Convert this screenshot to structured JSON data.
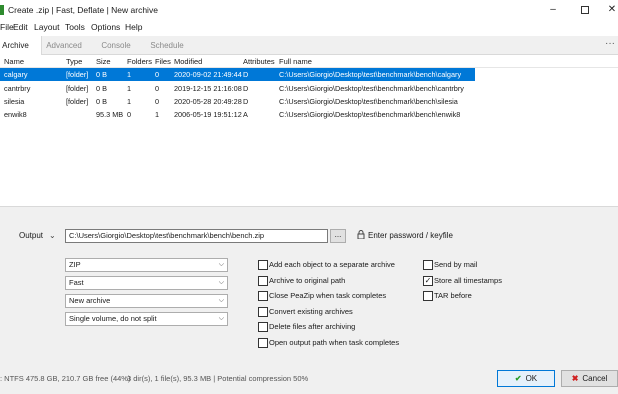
{
  "window": {
    "title": "Create .zip | Fast, Deflate | New archive",
    "minimize": "–",
    "close": "✕"
  },
  "menu": [
    "File",
    "Edit",
    "Layout",
    "Tools",
    "Options",
    "Help"
  ],
  "tabs": [
    "Archive",
    "Advanced",
    "Console",
    "Schedule"
  ],
  "tab_more": "···",
  "columns": [
    "Name",
    "Type",
    "Size",
    "Folders",
    "Files",
    "Modified",
    "Attributes",
    "Full name"
  ],
  "rows": [
    [
      "calgary",
      "[folder]",
      "0 B",
      "1",
      "0",
      "2020-09-02 21:49:44",
      "D",
      "C:\\Users\\Giorgio\\Desktop\\test\\benchmark\\bench\\calgary"
    ],
    [
      "cantrbry",
      "[folder]",
      "0 B",
      "1",
      "0",
      "2019-12-15 21:16:08",
      "D",
      "C:\\Users\\Giorgio\\Desktop\\test\\benchmark\\bench\\cantrbry"
    ],
    [
      "silesia",
      "[folder]",
      "0 B",
      "1",
      "0",
      "2020-05-28 20:49:28",
      "D",
      "C:\\Users\\Giorgio\\Desktop\\test\\benchmark\\bench\\silesia"
    ],
    [
      "enwik8",
      "",
      "95.3 MB",
      "0",
      "1",
      "2006-05-19 19:51:12",
      "A",
      "C:\\Users\\Giorgio\\Desktop\\test\\benchmark\\bench\\enwik8"
    ]
  ],
  "output": {
    "label": "Output",
    "path": "C:\\Users\\Giorgio\\Desktop\\test\\benchmark\\bench\\bench.zip",
    "browse": "...",
    "password": "Enter password / keyfile"
  },
  "combos": [
    "ZIP",
    "Fast",
    "New archive",
    "Single volume, do not split"
  ],
  "options_left": [
    {
      "label": "Add each object to a separate archive",
      "checked": false
    },
    {
      "label": "Archive to original path",
      "checked": false
    },
    {
      "label": "Close PeaZip when task completes",
      "checked": false
    },
    {
      "label": "Convert existing archives",
      "checked": false
    },
    {
      "label": "Delete files after archiving",
      "checked": false
    },
    {
      "label": "Open output path when task completes",
      "checked": false
    }
  ],
  "options_right": [
    {
      "label": "Send by mail",
      "checked": false
    },
    {
      "label": "Store all timestamps",
      "checked": true
    },
    {
      "label": "TAR before",
      "checked": false
    }
  ],
  "status": {
    "disk": ": NTFS 475.8 GB, 210.7 GB free (44%)",
    "summary": "3 dir(s), 1 file(s), 95.3 MB | Potential compression 50%"
  },
  "buttons": {
    "ok": "OK",
    "cancel": "Cancel"
  },
  "colors": {
    "selection": "#0078d7",
    "ok_icon": "#2a9d2a",
    "cancel_icon": "#d02020"
  }
}
